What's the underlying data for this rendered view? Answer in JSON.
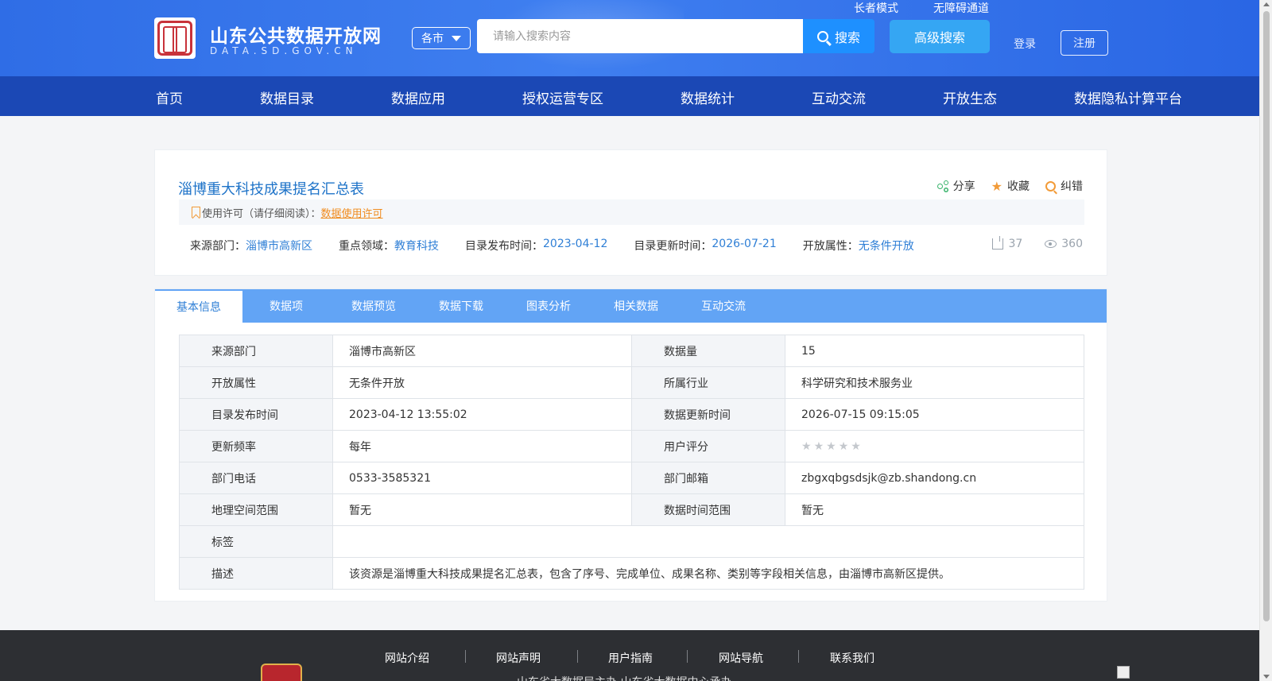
{
  "header": {
    "logo_title": "山东公共数据开放网",
    "logo_sub": "DATA.SD.GOV.CN",
    "city_select": "各市",
    "search_placeholder": "请输入搜索内容",
    "search_button": "搜索",
    "advanced_search": "高级搜索",
    "elder_mode": "长者模式",
    "accessibility": "无障碍通道",
    "login": "登录",
    "register": "注册",
    "colors": {
      "header_bg": "#3a78ee",
      "nav_bg": "#1b48b5",
      "search_btn": "#1e90ff",
      "adv_btn": "#35a6f3"
    }
  },
  "nav": {
    "items": [
      {
        "label": "首页"
      },
      {
        "label": "数据目录"
      },
      {
        "label": "数据应用"
      },
      {
        "label": "授权运营专区"
      },
      {
        "label": "数据统计"
      },
      {
        "label": "互动交流"
      },
      {
        "label": "开放生态"
      },
      {
        "label": "数据隐私计算平台"
      }
    ]
  },
  "dataset": {
    "title": "淄博重大科技成果提名汇总表",
    "actions": {
      "share": "分享",
      "favorite": "收藏",
      "report": "纠错"
    },
    "license_prefix": "使用许可（请仔细阅读）：",
    "license_link": "数据使用许可",
    "meta": {
      "source_label": "来源部门：",
      "source_value": "淄博市高新区",
      "field_label": "重点领域：",
      "field_value": "教育科技",
      "publish_label": "目录发布时间：",
      "publish_value": "2023-04-12",
      "update_label": "目录更新时间：",
      "update_value": "2026-07-21",
      "open_label": "开放属性：",
      "open_value": "无条件开放"
    },
    "downloads": "37",
    "views": "360"
  },
  "tabs": [
    {
      "label": "基本信息",
      "active": true
    },
    {
      "label": "数据项"
    },
    {
      "label": "数据预览"
    },
    {
      "label": "数据下载"
    },
    {
      "label": "图表分析"
    },
    {
      "label": "相关数据"
    },
    {
      "label": "互动交流"
    }
  ],
  "info": {
    "source_dept_label": "来源部门",
    "source_dept": "淄博市高新区",
    "data_count_label": "数据量",
    "data_count": "15",
    "open_attr_label": "开放属性",
    "open_attr": "无条件开放",
    "industry_label": "所属行业",
    "industry": "科学研究和技术服务业",
    "publish_time_label": "目录发布时间",
    "publish_time": "2023-04-12 13:55:02",
    "data_update_label": "数据更新时间",
    "data_update": "2026-07-15 09:15:05",
    "frequency_label": "更新频率",
    "frequency": "每年",
    "rating_label": "用户评分",
    "rating": 0,
    "rating_max": 5,
    "phone_label": "部门电话",
    "phone": "0533-3585321",
    "email_label": "部门邮箱",
    "email": "zbgxqbgsdsjk@zb.shandong.cn",
    "geo_label": "地理空间范围",
    "geo": "暂无",
    "time_range_label": "数据时间范围",
    "time_range": "暂无",
    "tags_label": "标签",
    "tags": "",
    "desc_label": "描述",
    "desc": "该资源是淄博重大科技成果提名汇总表，包含了序号、完成单位、成果名称、类别等字段相关信息，由淄博市高新区提供。"
  },
  "footer": {
    "links": [
      {
        "label": "网站介绍"
      },
      {
        "label": "网站声明"
      },
      {
        "label": "用户指南"
      },
      {
        "label": "网站导航"
      },
      {
        "label": "联系我们"
      }
    ],
    "note": "山东省大数据局主办    山东省大数据中心承办"
  }
}
